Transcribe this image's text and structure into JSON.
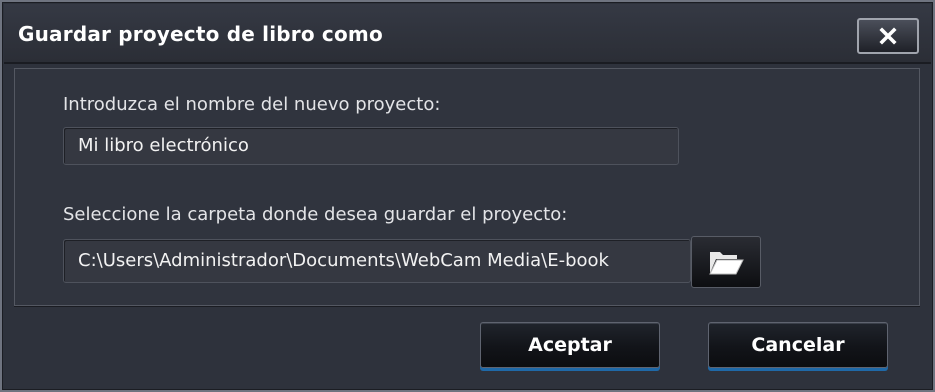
{
  "dialog": {
    "title": "Guardar proyecto de libro como",
    "close_icon": "close-icon"
  },
  "form": {
    "name_label": "Introduzca el nombre del nuevo proyecto:",
    "name_value": "Mi libro electrónico",
    "folder_label": "Seleccione la carpeta donde desea guardar el proyecto:",
    "folder_value": "C:\\Users\\Administrador\\Documents\\WebCam Media\\E-book",
    "browse_icon": "folder-open-icon"
  },
  "buttons": {
    "accept_label": "Aceptar",
    "cancel_label": "Cancelar"
  },
  "colors": {
    "background": "#2e323c",
    "text": "#e3e4e7",
    "accent": "#1f69a8"
  }
}
